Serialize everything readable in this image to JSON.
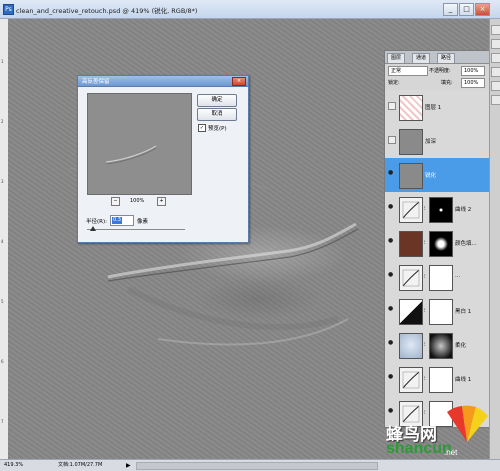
{
  "window": {
    "title": "clean_and_creative_retouch.psd @ 419% (锐化, RGB/8*)",
    "controls": [
      "_",
      "□",
      "×"
    ]
  },
  "ruler": [
    "1",
    "2",
    "3",
    "4",
    "5",
    "6",
    "7"
  ],
  "status": {
    "zoom": "419.3%",
    "doc_size": "文档:1.07M/27.7M",
    "arrow": "▶"
  },
  "dialog": {
    "title": "高反差保留",
    "close": "×",
    "ok_label": "确定",
    "cancel_label": "取消",
    "preview_check": "✓",
    "preview_label": "预览(P)",
    "zoom_out": "−",
    "zoom_level": "100%",
    "zoom_in": "+",
    "radius_label": "半径(R):",
    "radius_value": "0.3",
    "radius_unit": "像素",
    "slider_level": 0.03
  },
  "layers_panel": {
    "tabs": [
      "图层",
      "通道",
      "路径"
    ],
    "blend_mode": "正常",
    "opacity_label": "不透明度:",
    "opacity_value": "100%",
    "lock_label": "锁定:",
    "fill_label": "填充:",
    "fill_value": "100%",
    "eye_glyph": "●",
    "chain_glyph": "⁝",
    "layers": [
      {
        "name": "图层 1",
        "visible": false,
        "thumb": "pattern",
        "selected": false
      },
      {
        "name": "加深",
        "visible": false,
        "thumb": "gray",
        "selected": false
      },
      {
        "name": "锐化",
        "visible": true,
        "thumb": "gray",
        "selected": true
      },
      {
        "name": "曲线 2",
        "visible": true,
        "thumb": "curve",
        "mask": "black-dot",
        "selected": false
      },
      {
        "name": "颜色填...",
        "visible": true,
        "thumb": "brown",
        "mask": "glow",
        "selected": false
      },
      {
        "name": "...",
        "visible": true,
        "thumb": "adjust",
        "mask": "white",
        "selected": false
      },
      {
        "name": "黑白 1",
        "visible": true,
        "thumb": "bw",
        "mask": "white",
        "selected": false
      },
      {
        "name": "柔化",
        "visible": true,
        "thumb": "face",
        "mask": "face-mask",
        "selected": false
      },
      {
        "name": "曲线 1",
        "visible": true,
        "thumb": "curve",
        "mask": "white",
        "selected": false
      },
      {
        "name": "色阶...",
        "visible": true,
        "thumb": "levels",
        "mask": "white",
        "selected": false
      },
      {
        "name": "组 1",
        "visible": true,
        "thumb": "folder",
        "selected": false
      }
    ]
  },
  "watermark": {
    "cn": "蜂鸟网",
    "en": "shancun",
    "domain": ".net"
  },
  "colors": {
    "selected_layer": "#4a9be8",
    "canvas": "#878787",
    "fill_layer": "#6b3526"
  }
}
